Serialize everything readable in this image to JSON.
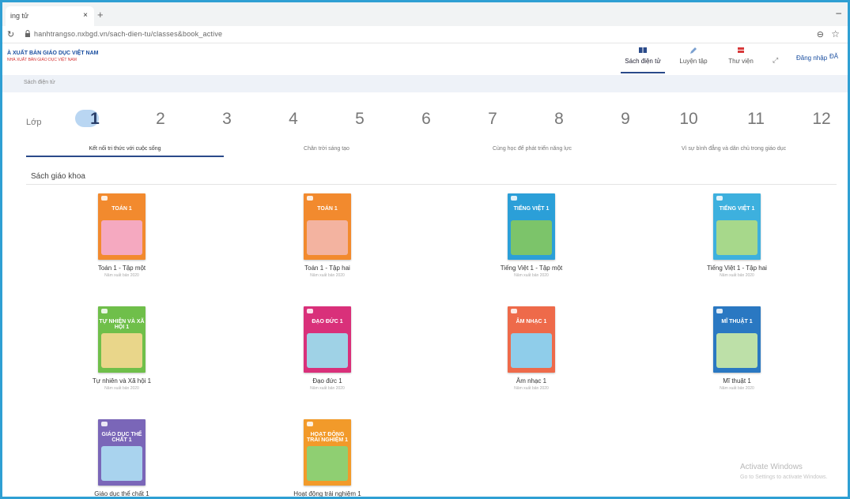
{
  "browser": {
    "tab_title": "ing tử",
    "close_label": "×",
    "new_tab_label": "+",
    "minimize_label": "–",
    "reload_label": "↻",
    "lock_label": "🔒",
    "url": "hanhtrangso.nxbgd.vn/sach-dien-tu/classes&book_active",
    "zoom_label": "⊖",
    "bookmark_label": "☆"
  },
  "site": {
    "logo_line1": "À XUẤT BẢN GIÁO DỤC VIỆT NAM",
    "logo_line2": "NHÀ XUẤT BẢN GIÁO DỤC VIỆT NAM",
    "nav": [
      {
        "label": "Sách điện tử",
        "icon": "book-icon"
      },
      {
        "label": "Luyện tập",
        "icon": "pencil-icon"
      },
      {
        "label": "Thư viện",
        "icon": "library-icon"
      }
    ],
    "nav_extra": "⤢",
    "login": "Đăng nhập",
    "user": "ĐĂ"
  },
  "breadcrumb": "Sách điện tử",
  "grades": {
    "label": "Lớp",
    "items": [
      "1",
      "2",
      "3",
      "4",
      "5",
      "6",
      "7",
      "8",
      "9",
      "10",
      "11",
      "12"
    ],
    "active": "1"
  },
  "series_tabs": [
    "Kết nối tri thức với cuộc sống",
    "Chân trời sáng tạo",
    "Cùng học để phát triển năng lực",
    "Vì sự bình đẳng và dân chủ trong giáo dục"
  ],
  "section_title": "Sách giáo khoa",
  "books": [
    {
      "title": "Toán 1 - Tập một",
      "cover_title": "TOÁN 1",
      "year": "Năm xuất bản 2020",
      "color": "#f28a2e",
      "scene": "#f5a9c0"
    },
    {
      "title": "Toán 1 - Tập hai",
      "cover_title": "TOÁN 1",
      "year": "Năm xuất bản 2020",
      "color": "#f28a2e",
      "scene": "#f3b3a0"
    },
    {
      "title": "Tiếng Việt 1 - Tập một",
      "cover_title": "TIẾNG VIỆT 1",
      "year": "Năm xuất bản 2020",
      "color": "#2b9fd8",
      "scene": "#7cc46a"
    },
    {
      "title": "Tiếng Việt 1 - Tập hai",
      "cover_title": "TIẾNG VIỆT 1",
      "year": "Năm xuất bản 2020",
      "color": "#3db0de",
      "scene": "#a7d88b"
    },
    {
      "title": "Tự nhiên và Xã hội 1",
      "cover_title": "TỰ NHIÊN VÀ XÃ HỘI 1",
      "year": "Năm xuất bản 2020",
      "color": "#6fbf4a",
      "scene": "#e9d68a"
    },
    {
      "title": "Đạo đức 1",
      "cover_title": "ĐẠO ĐỨC 1",
      "year": "Năm xuất bản 2020",
      "color": "#d9307a",
      "scene": "#9fd2e6"
    },
    {
      "title": "Âm nhạc 1",
      "cover_title": "ÂM NHẠC 1",
      "year": "Năm xuất bản 2020",
      "color": "#ee6a4a",
      "scene": "#8fcdea"
    },
    {
      "title": "Mĩ thuật 1",
      "cover_title": "MĨ THUẬT 1",
      "year": "Năm xuất bản 2020",
      "color": "#2a78c2",
      "scene": "#bde0a8"
    },
    {
      "title": "Giáo dục thể chất 1",
      "cover_title": "GIÁO DỤC THỂ CHẤT 1",
      "year": "",
      "color": "#7a66b8",
      "scene": "#a9d3ee"
    },
    {
      "title": "Hoạt động trải nghiệm 1",
      "cover_title": "HOẠT ĐỘNG TRẢI NGHIỆM 1",
      "year": "",
      "color": "#f29a2a",
      "scene": "#8fcf72"
    }
  ],
  "watermark": {
    "title": "Activate Windows",
    "subtitle": "Go to Settings to activate Windows."
  }
}
